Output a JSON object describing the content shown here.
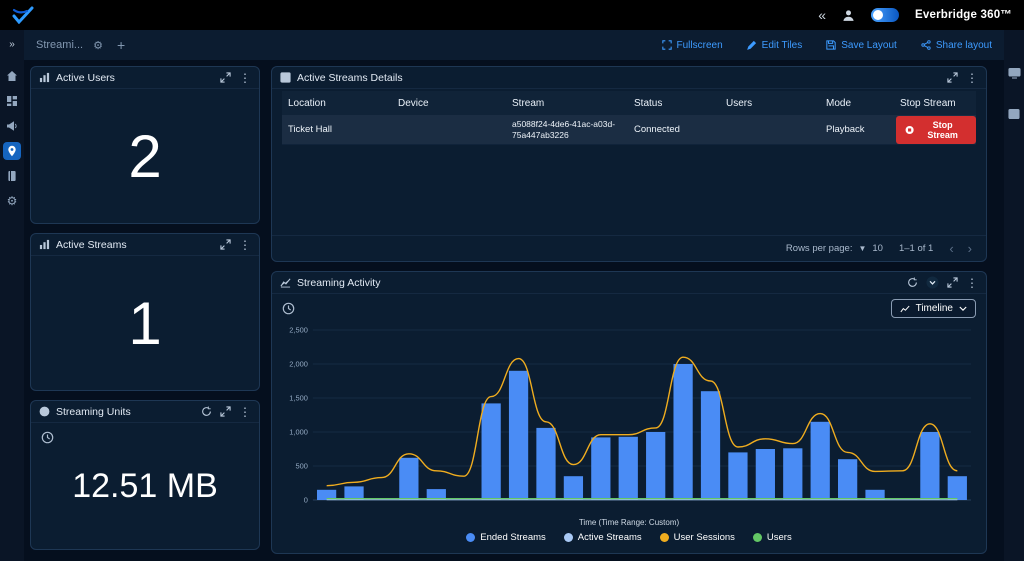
{
  "colors": {
    "accent": "#3d9bff",
    "danger": "#d32f2f",
    "nav_active": "#1565c0"
  },
  "topbar": {
    "brand": "Everbridge 360™"
  },
  "tabs_bar": {
    "active_tab": "Streami...",
    "add_tab": "+",
    "actions": {
      "fullscreen": "Fullscreen",
      "edit_tiles": "Edit Tiles",
      "save_layout": "Save Layout",
      "share_layout": "Share layout"
    }
  },
  "tiles": {
    "active_users": {
      "title": "Active Users",
      "value": "2"
    },
    "active_streams": {
      "title": "Active Streams",
      "value": "1"
    },
    "streaming_units": {
      "title": "Streaming Units",
      "value": "12.51 MB"
    },
    "details": {
      "title": "Active Streams Details",
      "columns": [
        "Location",
        "Device",
        "Stream",
        "Status",
        "Users",
        "Mode",
        "Stop Stream"
      ],
      "rows": [
        {
          "location": "Ticket Hall",
          "device_redacted": true,
          "stream": "a5088f24-4de6-41ac-a03d-75a447ab3226",
          "status": "Connected",
          "users_redacted": true,
          "mode": "Playback",
          "stop_label": "Stop Stream"
        }
      ],
      "footer": {
        "rows_per_page_label": "Rows per page:",
        "rows_per_page_value": "10",
        "range_label": "1–1 of 1"
      }
    },
    "activity": {
      "title": "Streaming Activity",
      "timeline_label": "Timeline",
      "chart_data": {
        "type": "bar+line",
        "title": "Streaming Activity",
        "xlabel": "Time (Time Range: Custom)",
        "ylabel": "",
        "ylim": [
          0,
          2500
        ],
        "yticks": [
          0,
          500,
          1000,
          1500,
          2000,
          2500
        ],
        "x_tick_labels_visible": false,
        "points": 24,
        "legend_position": "bottom",
        "series": [
          {
            "name": "Ended Streams",
            "type": "bar",
            "color": "#4a8cf5",
            "values": [
              150,
              200,
              0,
              620,
              160,
              0,
              1420,
              1900,
              1060,
              350,
              920,
              930,
              1000,
              2000,
              1600,
              700,
              750,
              760,
              1150,
              600,
              150,
              0,
              1000,
              350
            ]
          },
          {
            "name": "Active Streams",
            "type": "line",
            "color": "#a9c9f5",
            "width": 1,
            "values": [
              5,
              5,
              5,
              5,
              5,
              5,
              5,
              5,
              5,
              5,
              5,
              5,
              5,
              5,
              5,
              5,
              5,
              5,
              5,
              5,
              5,
              5,
              5,
              5
            ]
          },
          {
            "name": "User Sessions",
            "type": "line",
            "color": "#f0ad1f",
            "width": 1.4,
            "values": [
              210,
              260,
              330,
              680,
              430,
              350,
              1520,
              2080,
              1150,
              520,
              960,
              960,
              1060,
              2100,
              1750,
              780,
              900,
              830,
              1270,
              700,
              420,
              430,
              1120,
              430
            ]
          },
          {
            "name": "Users",
            "type": "line",
            "color": "#63c765",
            "width": 1.2,
            "values": [
              20,
              20,
              20,
              20,
              20,
              20,
              20,
              20,
              20,
              20,
              20,
              20,
              20,
              20,
              20,
              20,
              20,
              20,
              20,
              20,
              20,
              20,
              20,
              20
            ]
          }
        ]
      }
    }
  }
}
